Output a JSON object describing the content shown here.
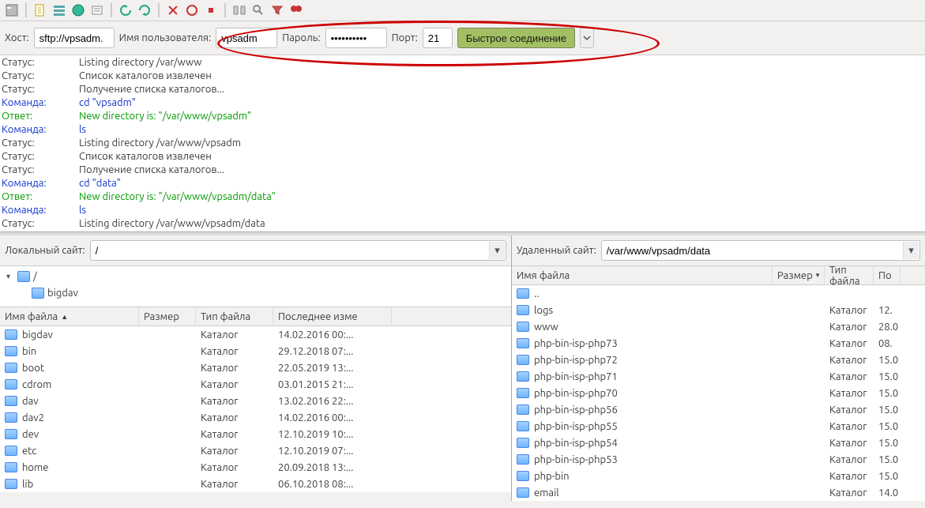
{
  "connect": {
    "host_label": "Хост:",
    "host_value": "sftp://vpsadm.",
    "user_label": "Имя пользователя:",
    "user_value": "vpsadm",
    "pass_label": "Пароль:",
    "pass_value": "••••••••••",
    "port_label": "Порт:",
    "port_value": "21",
    "quick_label": "Быстрое соединение"
  },
  "log": [
    {
      "type": "status",
      "label": "Статус:",
      "msg": "Listing directory /var/www"
    },
    {
      "type": "status",
      "label": "Статус:",
      "msg": "Список каталогов извлечен"
    },
    {
      "type": "status",
      "label": "Статус:",
      "msg": "Получение списка каталогов..."
    },
    {
      "type": "command",
      "label": "Команда:",
      "msg": "cd \"vpsadm\""
    },
    {
      "type": "response",
      "label": "Ответ:",
      "msg": "New directory is: \"/var/www/vpsadm\""
    },
    {
      "type": "command",
      "label": "Команда:",
      "msg": "ls"
    },
    {
      "type": "status",
      "label": "Статус:",
      "msg": "Listing directory /var/www/vpsadm"
    },
    {
      "type": "status",
      "label": "Статус:",
      "msg": "Список каталогов извлечен"
    },
    {
      "type": "status",
      "label": "Статус:",
      "msg": "Получение списка каталогов..."
    },
    {
      "type": "command",
      "label": "Команда:",
      "msg": "cd \"data\""
    },
    {
      "type": "response",
      "label": "Ответ:",
      "msg": "New directory is: \"/var/www/vpsadm/data\""
    },
    {
      "type": "command",
      "label": "Команда:",
      "msg": "ls"
    },
    {
      "type": "status",
      "label": "Статус:",
      "msg": "Listing directory /var/www/vpsadm/data"
    },
    {
      "type": "status",
      "label": "Статус:",
      "msg": "Список каталогов извлечен"
    }
  ],
  "left": {
    "site_label": "Локальный сайт:",
    "path": "/",
    "tree": [
      "/",
      "bigdav"
    ],
    "columns": {
      "name": "Имя файла",
      "size": "Размер",
      "type": "Тип файла",
      "date": "Последнее изме"
    },
    "rows": [
      {
        "name": "bigdav",
        "type": "Каталог",
        "date": "14.02.2016 00:..."
      },
      {
        "name": "bin",
        "type": "Каталог",
        "date": "29.12.2018 07:..."
      },
      {
        "name": "boot",
        "type": "Каталог",
        "date": "22.05.2019 13:..."
      },
      {
        "name": "cdrom",
        "type": "Каталог",
        "date": "03.01.2015 21:..."
      },
      {
        "name": "dav",
        "type": "Каталог",
        "date": "13.02.2016 22:..."
      },
      {
        "name": "dav2",
        "type": "Каталог",
        "date": "14.02.2016 00:..."
      },
      {
        "name": "dev",
        "type": "Каталог",
        "date": "12.10.2019 10:..."
      },
      {
        "name": "etc",
        "type": "Каталог",
        "date": "12.10.2019 07:..."
      },
      {
        "name": "home",
        "type": "Каталог",
        "date": "20.09.2018 13:..."
      },
      {
        "name": "lib",
        "type": "Каталог",
        "date": "06.10.2018 08:..."
      }
    ]
  },
  "right": {
    "site_label": "Удаленный сайт:",
    "path": "/var/www/vpsadm/data",
    "columns": {
      "name": "Имя файла",
      "size": "Размер",
      "type": "Тип файла",
      "date": "По"
    },
    "rows": [
      {
        "name": "..",
        "type": "",
        "date": ""
      },
      {
        "name": "logs",
        "type": "Каталог",
        "date": "12."
      },
      {
        "name": "www",
        "type": "Каталог",
        "date": "28.0"
      },
      {
        "name": "php-bin-isp-php73",
        "type": "Каталог",
        "date": "08."
      },
      {
        "name": "php-bin-isp-php72",
        "type": "Каталог",
        "date": "15.0"
      },
      {
        "name": "php-bin-isp-php71",
        "type": "Каталог",
        "date": "15.0"
      },
      {
        "name": "php-bin-isp-php70",
        "type": "Каталог",
        "date": "15.0"
      },
      {
        "name": "php-bin-isp-php56",
        "type": "Каталог",
        "date": "15.0"
      },
      {
        "name": "php-bin-isp-php55",
        "type": "Каталог",
        "date": "15.0"
      },
      {
        "name": "php-bin-isp-php54",
        "type": "Каталог",
        "date": "15.0"
      },
      {
        "name": "php-bin-isp-php53",
        "type": "Каталог",
        "date": "15.0"
      },
      {
        "name": "php-bin",
        "type": "Каталог",
        "date": "15.0"
      },
      {
        "name": "email",
        "type": "Каталог",
        "date": "14.0"
      }
    ]
  }
}
